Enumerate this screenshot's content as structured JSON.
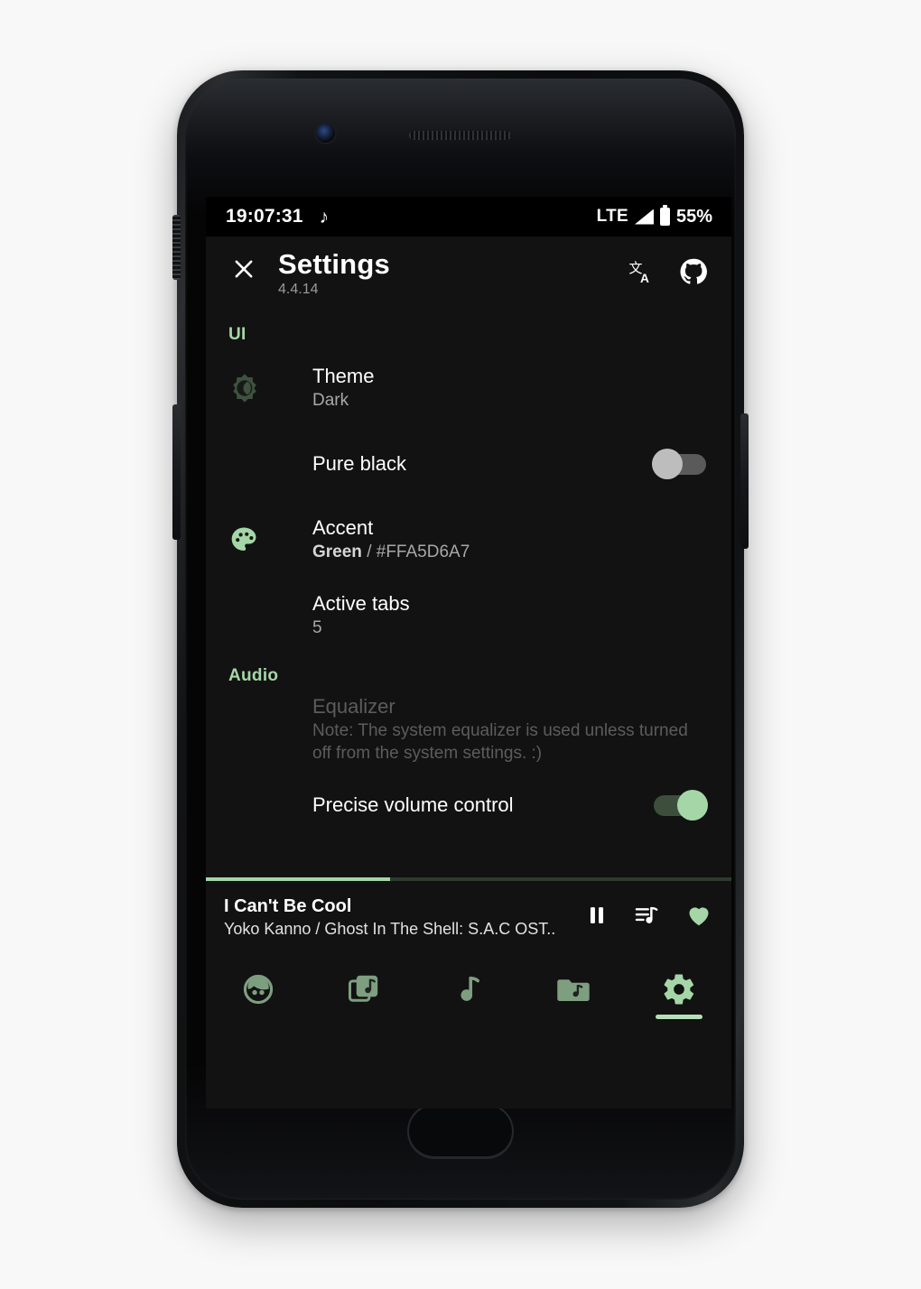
{
  "status_bar": {
    "clock": "19:07:31",
    "notification_icon": "music-note-icon",
    "network": "LTE",
    "signal_icon": "signal-bars-icon",
    "battery_icon": "battery-icon",
    "battery_percent": "55%"
  },
  "app_bar": {
    "close_icon": "close-icon",
    "title": "Settings",
    "version": "4.4.14",
    "translate_icon": "translate-icon",
    "github_icon": "github-icon"
  },
  "sections": [
    {
      "label": "UI",
      "items": [
        {
          "icon": "brightness-theme-icon",
          "title": "Theme",
          "summary": "Dark",
          "control": "none"
        },
        {
          "icon": "none",
          "title": "Pure black",
          "summary": "",
          "control": "toggle-off"
        },
        {
          "icon": "palette-icon",
          "title": "Accent",
          "summary_name": "Green",
          "summary_rest": " / #FFA5D6A7",
          "control": "none"
        },
        {
          "icon": "none",
          "title": "Active tabs",
          "summary": "5",
          "control": "none"
        }
      ]
    },
    {
      "label": "Audio",
      "items": [
        {
          "icon": "none",
          "title": "Equalizer",
          "summary": "Note: The system equalizer is used unless turned off from the system settings. :)",
          "control": "none",
          "disabled": true
        },
        {
          "icon": "none",
          "title": "Precise volume control",
          "summary": "",
          "control": "toggle-on"
        }
      ]
    }
  ],
  "now_playing": {
    "title": "I Can't Be Cool",
    "artist_album": "Yoko Kanno / Ghost In The Shell: S.A.C OST..",
    "progress_percent": 35,
    "pause_icon": "pause-icon",
    "queue_icon": "queue-music-icon",
    "favorite_icon": "heart-filled-icon"
  },
  "bottom_nav": [
    {
      "icon": "artists-face-icon",
      "name": "artists",
      "active": false
    },
    {
      "icon": "albums-stack-icon",
      "name": "albums",
      "active": false
    },
    {
      "icon": "songs-note-icon",
      "name": "songs",
      "active": false
    },
    {
      "icon": "folders-music-icon",
      "name": "folders",
      "active": false
    },
    {
      "icon": "settings-gear-icon",
      "name": "settings",
      "active": true
    }
  ],
  "colors": {
    "accent": "#A5D6A7",
    "accent_dim": "#7E9E80",
    "background": "#121212",
    "status_bar_bg": "#000000"
  }
}
